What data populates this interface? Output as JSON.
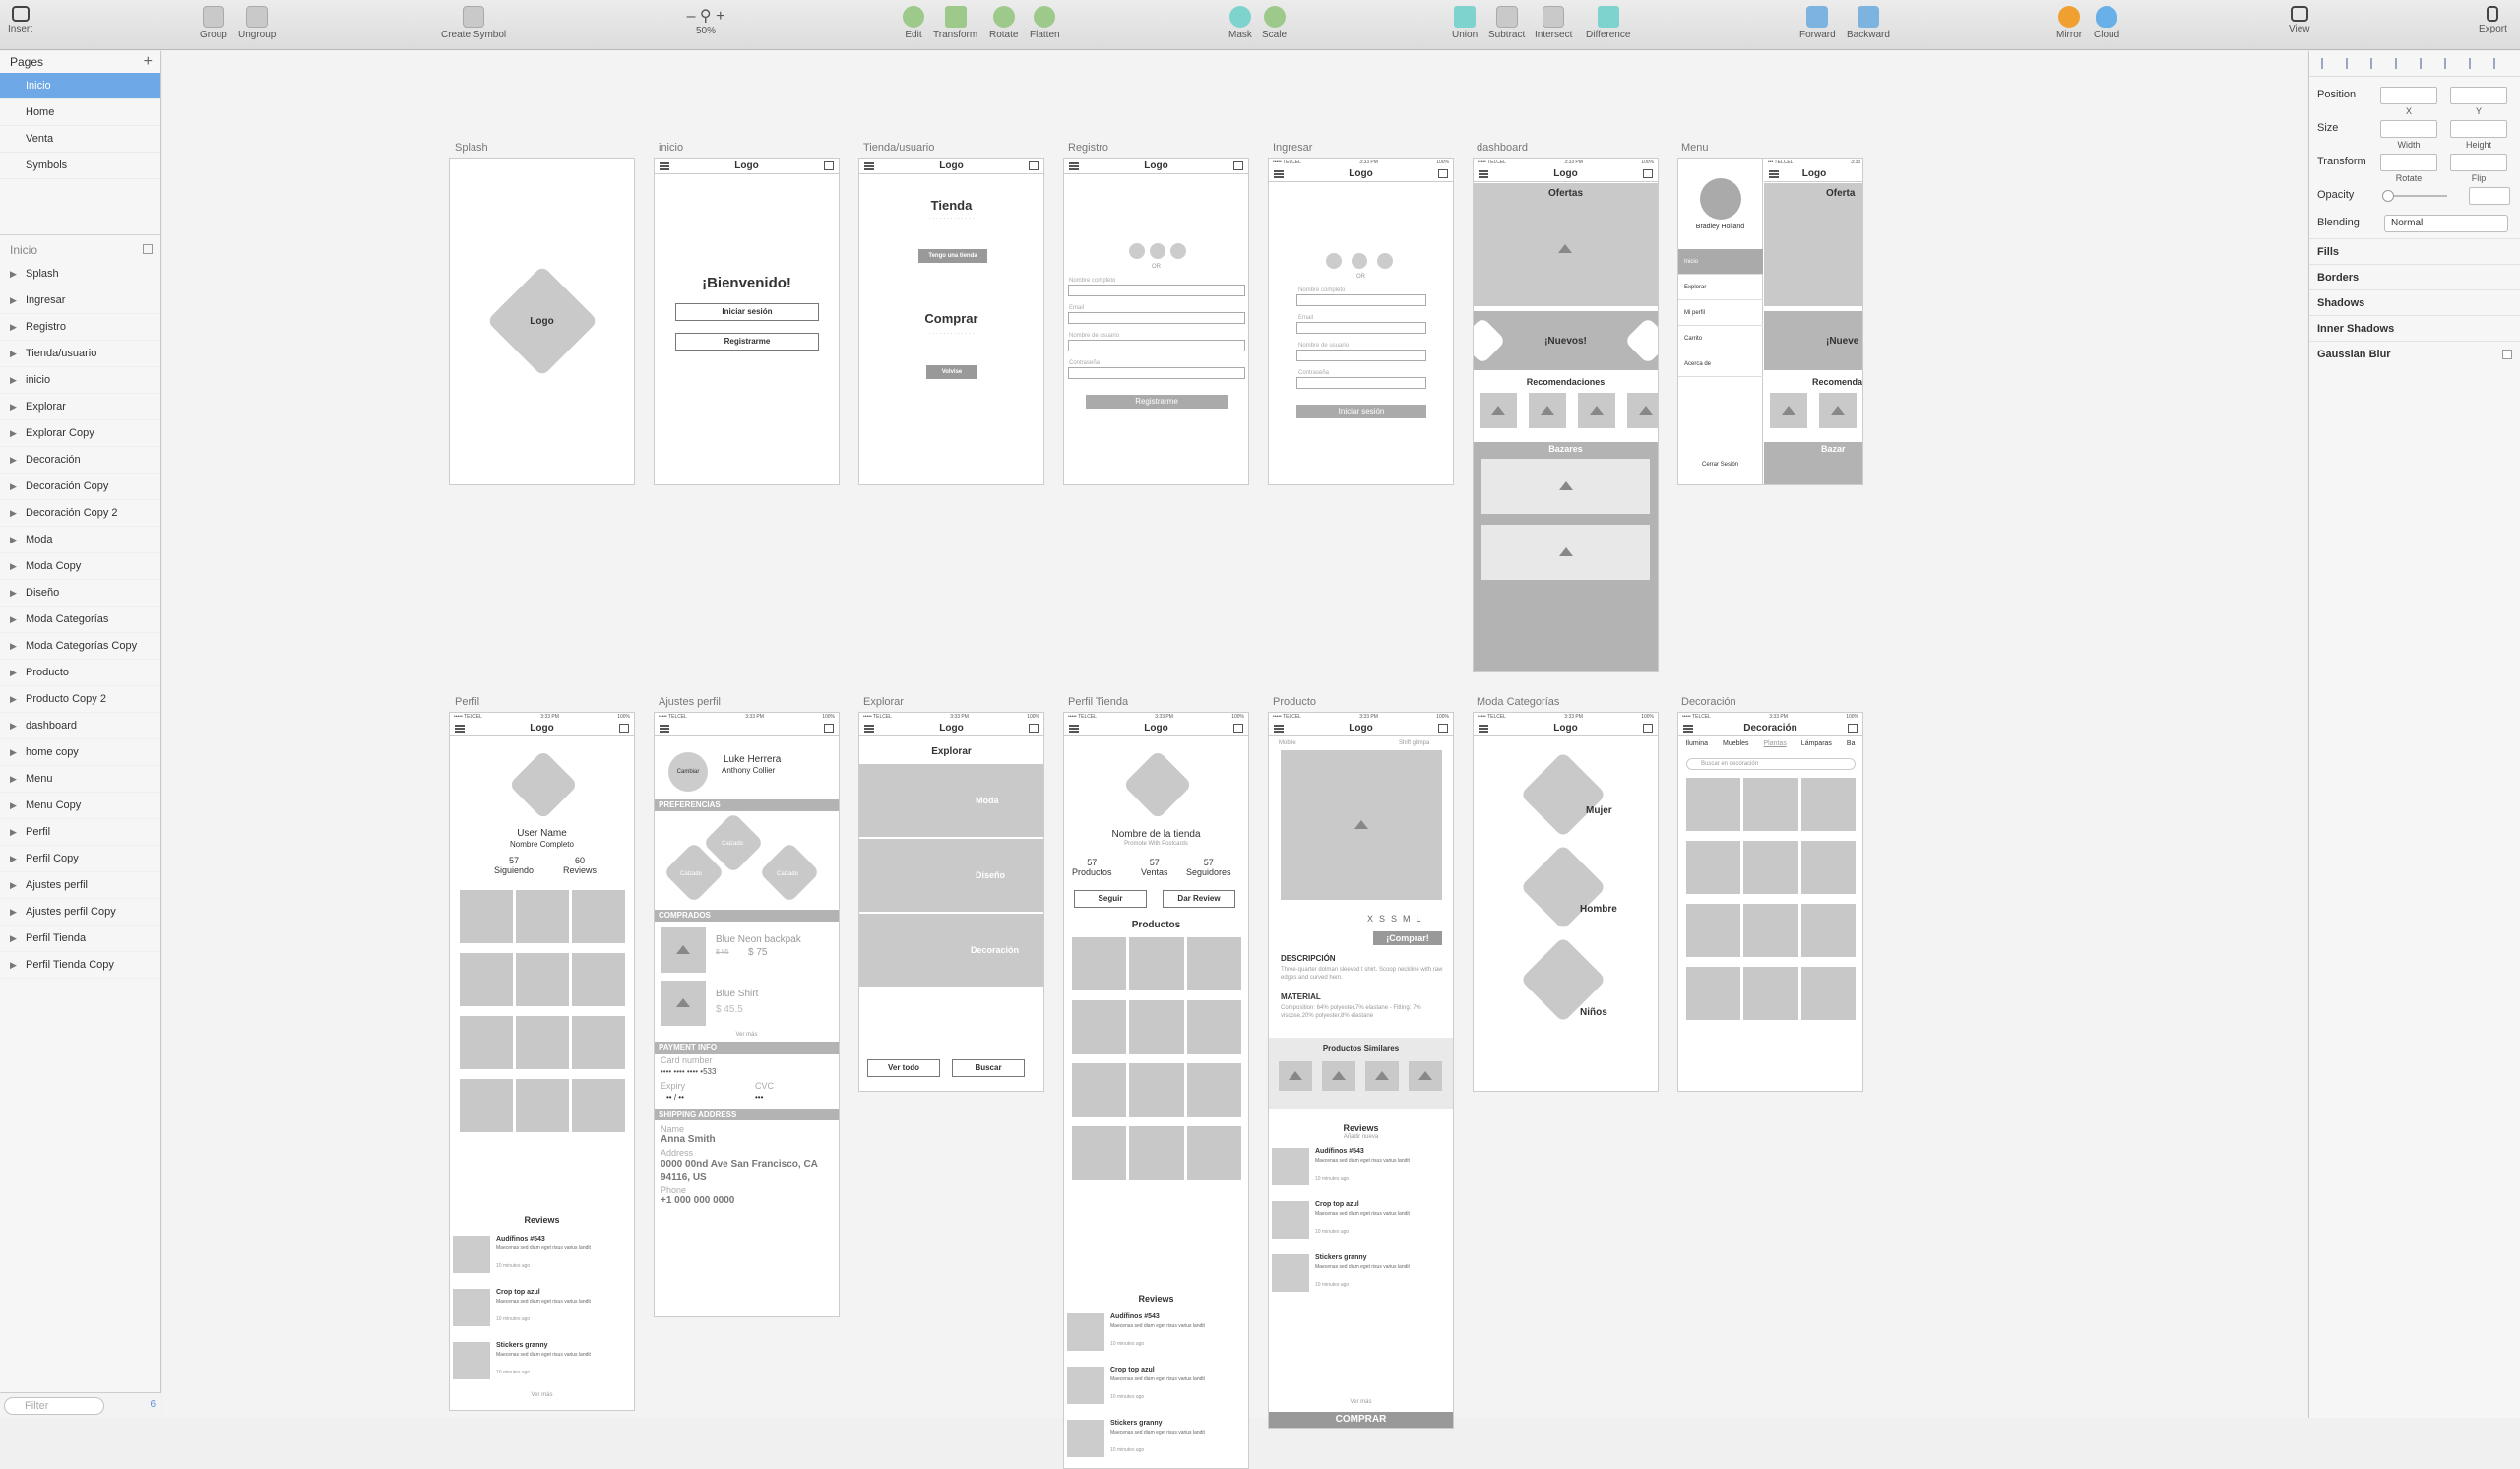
{
  "toolbar": {
    "insert": "Insert",
    "group": "Group",
    "ungroup": "Ungroup",
    "create_symbol": "Create Symbol",
    "zoom": "50%",
    "zoom_minus": "–",
    "zoom_plus": "+",
    "edit": "Edit",
    "transform": "Transform",
    "rotate": "Rotate",
    "flatten": "Flatten",
    "mask": "Mask",
    "scale": "Scale",
    "union": "Union",
    "subtract": "Subtract",
    "intersect": "Intersect",
    "difference": "Difference",
    "forward": "Forward",
    "backward": "Backward",
    "mirror": "Mirror",
    "cloud": "Cloud",
    "view": "View",
    "export": "Export"
  },
  "pages": {
    "header": "Pages",
    "add": "+",
    "items": [
      "Inicio",
      "Home",
      "Venta",
      "Symbols"
    ],
    "selected": "Inicio"
  },
  "layers": {
    "header": "Inicio",
    "items": [
      "Splash",
      "Ingresar",
      "Registro",
      "Tienda/usuario",
      "inicio",
      "Explorar",
      "Explorar Copy",
      "Decoración",
      "Decoración Copy",
      "Decoración Copy 2",
      "Moda",
      "Moda Copy",
      "Diseño",
      "Moda Categorías",
      "Moda Categorías Copy",
      "Producto",
      "Producto Copy 2",
      "dashboard",
      "home copy",
      "Menu",
      "Menu Copy",
      "Perfil",
      "Perfil Copy",
      "Ajustes perfil",
      "Ajustes perfil Copy",
      "Perfil Tienda",
      "Perfil Tienda Copy"
    ]
  },
  "filter": {
    "placeholder": "Filter",
    "count": "6"
  },
  "inspector": {
    "position": "Position",
    "x": "X",
    "y": "Y",
    "size": "Size",
    "width": "Width",
    "height": "Height",
    "transform": "Transform",
    "rotate": "Rotate",
    "flip": "Flip",
    "opacity": "Opacity",
    "blending": "Blending",
    "blend_value": "Normal",
    "fills": "Fills",
    "borders": "Borders",
    "shadows": "Shadows",
    "inner_shadows": "Inner Shadows",
    "gaussian_blur": "Gaussian Blur"
  },
  "artboards": {
    "splash": {
      "title": "Splash",
      "logo": "Logo"
    },
    "inicio": {
      "title": "inicio",
      "logo": "Logo",
      "welcome": "¡Bienvenido!",
      "login": "Iniciar sesión",
      "register": "Registrarme"
    },
    "tienda": {
      "title": "Tienda/usuario",
      "logo": "Logo",
      "h1": "Tienda",
      "btn1": "Tengo una tienda",
      "h2": "Comprar",
      "btn2": "Volvise"
    },
    "registro": {
      "title": "Registro",
      "logo": "Logo",
      "or": "OR",
      "f1": "Nombre completo",
      "f2": "Email",
      "f3": "Nombre de usuario",
      "f4": "Contraseña",
      "btn": "Registrarme"
    },
    "ingresar": {
      "title": "Ingresar",
      "logo": "Logo",
      "or": "OR",
      "f1": "Nombre completo",
      "f2": "Email",
      "f3": "Nombre de usuario",
      "f4": "Contraseña",
      "btn": "Iniciar sesión"
    },
    "dashboard": {
      "title": "dashboard",
      "logo": "Logo",
      "ofertas": "Ofertas",
      "nuevos": "¡Nuevos!",
      "recomendaciones": "Recomendaciones",
      "bazares": "Bazares"
    },
    "menu": {
      "title": "Menu",
      "user": "Bradley Holland",
      "items": [
        "Inicio",
        "Explorar",
        "Mi perfil",
        "Carrito",
        "Acerca de"
      ],
      "logout": "Cerrar Sesión",
      "logo": "Logo",
      "ofertas": "Oferta",
      "nuevos": "¡Nueve",
      "recomendaciones": "Recomenda",
      "bazares": "Bazar"
    },
    "perfil": {
      "title": "Perfil",
      "logo": "Logo",
      "user": "User Name",
      "full": "Nombre Completo",
      "seg_n": "57",
      "seg": "Siguiendo",
      "rev_n": "60",
      "rev": "Reviews",
      "reviews": "Reviews",
      "more": "Ver más"
    },
    "ajustes": {
      "title": "Ajustes perfil",
      "cambiar": "Cambiar",
      "name": "Luke Herrera",
      "user": "Anthony Collier",
      "pref": "PREFERENCIAS",
      "pref_items": [
        "Calzado",
        "Calzado",
        "Calzado"
      ],
      "comprados": "COMPRADOS",
      "p1": "Blue Neon backpak",
      "p1_old": "$ 95",
      "p1_price": "$ 75",
      "p2": "Blue Shirt",
      "p2_price": "$ 45.5",
      "more": "Ver más",
      "payment": "PAYMENT INFO",
      "card": "Card number",
      "card_val": "•••• •••• •••• •533",
      "expiry": "Expiry",
      "expiry_val": "•• / ••",
      "cvc": "CVC",
      "cvc_val": "•••",
      "shipping": "SHIPPING ADDRESS",
      "name_l": "Name",
      "name_v": "Anna Smith",
      "addr_l": "Address",
      "addr_v": "0000 00nd Ave San Francisco, CA 94116, US",
      "phone_l": "Phone",
      "phone_v": "+1 000 000 0000"
    },
    "explorar": {
      "title": "Explorar",
      "logo": "Logo",
      "h": "Explorar",
      "cats": [
        "Moda",
        "Diseño",
        "Decoración"
      ],
      "ver": "Ver todo",
      "buscar": "Buscar"
    },
    "perfil_tienda": {
      "title": "Perfil Tienda",
      "logo": "Logo",
      "name": "Nombre de la tienda",
      "sub": "Promote With Postcards",
      "prod_n": "57",
      "prod": "Productos",
      "ven_n": "57",
      "ven": "Ventas",
      "seg_n": "57",
      "seg": "Seguidores",
      "follow": "Seguir",
      "review": "Dar Review",
      "productos": "Productos",
      "reviews": "Reviews"
    },
    "producto": {
      "title": "Producto",
      "logo": "Logo",
      "left": "Mobile",
      "right": "Shift glimpa",
      "sizes": [
        "XS",
        "S",
        "M",
        "L"
      ],
      "buy": "¡Comprar!",
      "desc_h": "DESCRIPCIÓN",
      "desc": "Three-quarter dolman sleeved t shirt. Scoop neckline with raw edges and curved hem.",
      "mat_h": "MATERIAL",
      "mat": "Composition: 64% polyester,7% elastane - Fitting: 7% viscose,20% polyester,8% elastane",
      "similares": "Productos Similares",
      "reviews": "Reviews",
      "add": "Añadir nueva",
      "more": "Ver más",
      "buy2": "COMPRAR"
    },
    "moda_cat": {
      "title": "Moda Categorías",
      "logo": "Logo",
      "cats": [
        "Mujer",
        "Hombre",
        "Niños"
      ]
    },
    "decoracion": {
      "title": "Decoración",
      "logo": "Decoración",
      "tabs": [
        "Ilumina",
        "Muebles",
        "Plantas",
        "Lámparas",
        "Ba"
      ],
      "search": "Buscar en decoración"
    },
    "reviews_list": [
      {
        "t": "Audífinos #543",
        "d": "Maecenas sed diam eget risus varius landit",
        "m": "10 minutes ago"
      },
      {
        "t": "Crop top azul",
        "d": "Maecenas sed diam eget risus varius landit",
        "m": "10 minutes ago"
      },
      {
        "t": "Stickers granny",
        "d": "Maecenas sed diam eget risus varius landit",
        "m": "10 minutes ago"
      }
    ]
  }
}
